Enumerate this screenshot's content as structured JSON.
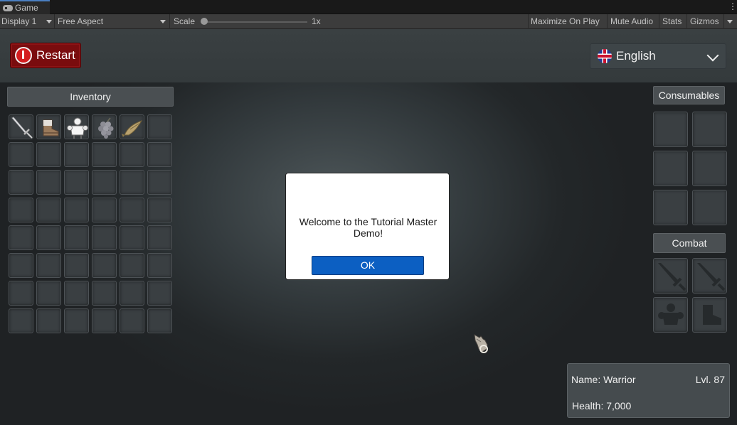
{
  "editor": {
    "tab_title": "Game",
    "display": "Display 1",
    "aspect": "Free Aspect",
    "scale_label": "Scale",
    "scale_value": "1x",
    "scale_fraction": 0.0,
    "maximize_on_play": "Maximize On Play",
    "mute_audio": "Mute Audio",
    "stats": "Stats",
    "gizmos": "Gizmos"
  },
  "game": {
    "restart_label": "Restart",
    "language": "English",
    "inventory_title": "Inventory",
    "inventory_items": [
      "sword-icon",
      "boot-icon",
      "armor-icon",
      "grapes-icon",
      "fish-icon"
    ],
    "consumables_title": "Consumables",
    "combat_title": "Combat",
    "combat_slots": [
      "sword-silhouette-icon",
      "sword-silhouette-icon",
      "armor-silhouette-icon",
      "boot-silhouette-icon"
    ],
    "dialog_message": "Welcome to the Tutorial Master Demo!",
    "dialog_ok": "OK",
    "character": {
      "name": "Name: Warrior",
      "level": "Lvl. 87",
      "health": "Health: 7,000"
    }
  },
  "colors": {
    "restart_red": "#7a0c0e",
    "ok_blue": "#0c5fc2",
    "editor_accent": "#4a7fc1"
  }
}
